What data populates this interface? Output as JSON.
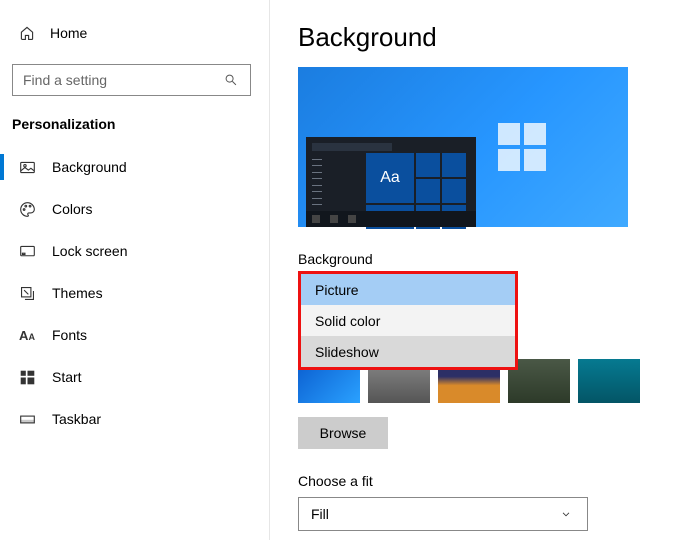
{
  "sidebar": {
    "home_label": "Home",
    "search_placeholder": "Find a setting",
    "category": "Personalization",
    "items": [
      {
        "label": "Background",
        "icon": "picture-icon",
        "active": true
      },
      {
        "label": "Colors",
        "icon": "palette-icon",
        "active": false
      },
      {
        "label": "Lock screen",
        "icon": "lockscreen-icon",
        "active": false
      },
      {
        "label": "Themes",
        "icon": "themes-icon",
        "active": false
      },
      {
        "label": "Fonts",
        "icon": "fonts-icon",
        "active": false
      },
      {
        "label": "Start",
        "icon": "start-icon",
        "active": false
      },
      {
        "label": "Taskbar",
        "icon": "taskbar-icon",
        "active": false
      }
    ]
  },
  "main": {
    "title": "Background",
    "preview_sample_text": "Aa",
    "background_label": "Background",
    "dropdown_options": [
      "Picture",
      "Solid color",
      "Slideshow"
    ],
    "dropdown_selected": "Picture",
    "dropdown_hovered": "Slideshow",
    "browse_label": "Browse",
    "fit_label": "Choose a fit",
    "fit_value": "Fill",
    "highlight_color": "#e11"
  }
}
